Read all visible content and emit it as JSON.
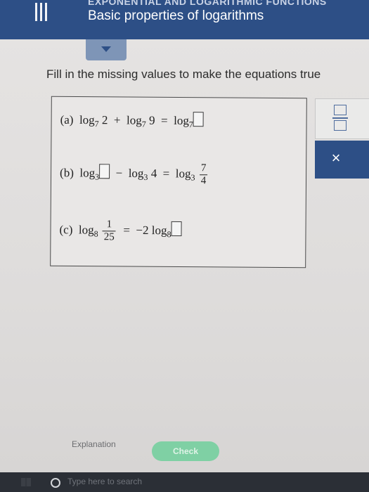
{
  "header": {
    "supertitle": "EXPONENTIAL AND LOGARITHMIC FUNCTIONS",
    "title": "Basic properties of logarithms"
  },
  "instruction": "Fill in the missing values to make the equations true",
  "problems": {
    "a": {
      "label": "(a)",
      "log": "log",
      "base": "7",
      "arg1": "2",
      "plus": "+",
      "arg2": "9",
      "equals": "="
    },
    "b": {
      "label": "(b)",
      "log": "log",
      "base": "3",
      "minus": "−",
      "arg2": "4",
      "equals": "=",
      "frac_num": "7",
      "frac_den": "4"
    },
    "c": {
      "label": "(c)",
      "log": "log",
      "base": "8",
      "frac_num": "1",
      "frac_den": "25",
      "equals": "=",
      "coef": "−2"
    }
  },
  "keypad": {
    "fraction_icon": "fraction-icon",
    "clear_label": "×"
  },
  "buttons": {
    "explanation": "Explanation",
    "check": "Check"
  },
  "taskbar": {
    "search_placeholder": "Type here to search"
  },
  "colors": {
    "header": "#2d4f86",
    "check_button": "#7fd0a4"
  }
}
